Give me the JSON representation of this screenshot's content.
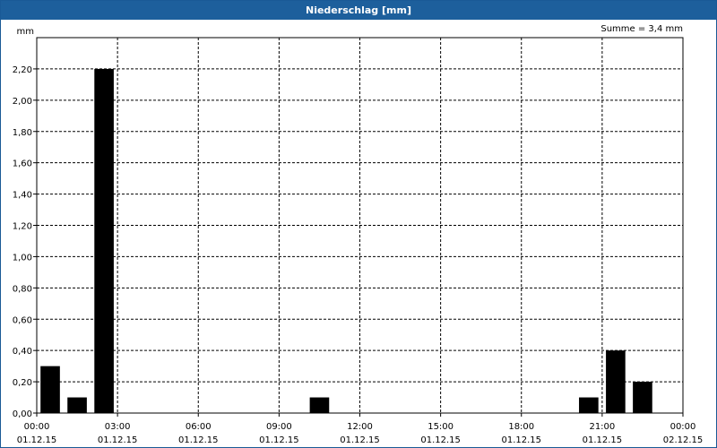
{
  "window": {
    "title": "Niederschlag [mm]"
  },
  "summary": {
    "text": "Summe = 3,4 mm"
  },
  "chart_data": {
    "type": "bar",
    "title": "Niederschlag [mm]",
    "ylabel": "mm",
    "ylim": [
      0,
      2.4
    ],
    "yticks": [
      "0,00",
      "0,20",
      "0,40",
      "0,60",
      "0,80",
      "1,00",
      "1,20",
      "1,40",
      "1,60",
      "1,80",
      "2,00",
      "2,20"
    ],
    "xrange_hours": [
      0,
      24
    ],
    "xticks": [
      {
        "time": "00:00",
        "date": "01.12.15"
      },
      {
        "time": "03:00",
        "date": "01.12.15"
      },
      {
        "time": "06:00",
        "date": "01.12.15"
      },
      {
        "time": "09:00",
        "date": "01.12.15"
      },
      {
        "time": "12:00",
        "date": "01.12.15"
      },
      {
        "time": "15:00",
        "date": "01.12.15"
      },
      {
        "time": "18:00",
        "date": "01.12.15"
      },
      {
        "time": "21:00",
        "date": "01.12.15"
      },
      {
        "time": "00:00",
        "date": "02.12.15"
      }
    ],
    "grid": true,
    "bar_color": "#000000",
    "series": [
      {
        "values": [
          {
            "hour": 0,
            "value": 0.3
          },
          {
            "hour": 1,
            "value": 0.1
          },
          {
            "hour": 2,
            "value": 2.2
          },
          {
            "hour": 10,
            "value": 0.1
          },
          {
            "hour": 20,
            "value": 0.1
          },
          {
            "hour": 21,
            "value": 0.4
          },
          {
            "hour": 22,
            "value": 0.2
          }
        ]
      }
    ]
  }
}
